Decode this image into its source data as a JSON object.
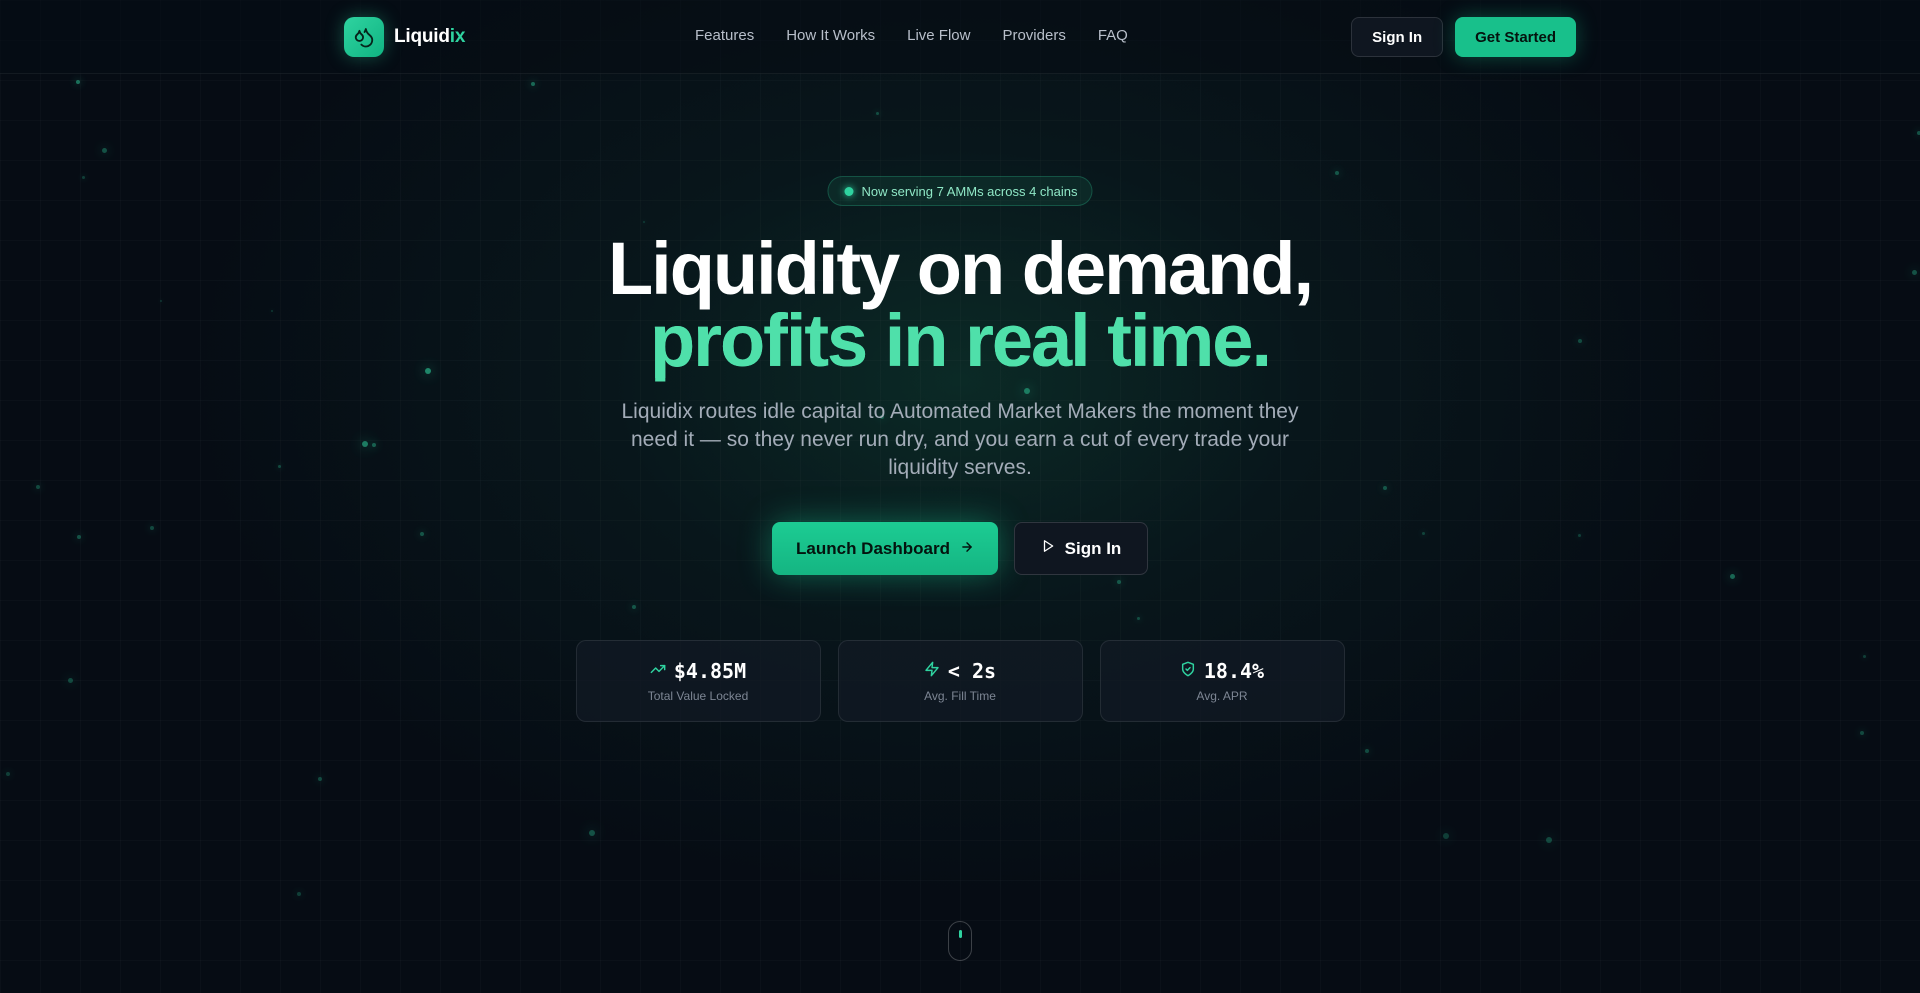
{
  "brand": {
    "name_prefix": "Liquid",
    "name_suffix": "ix",
    "logo_icon": "droplets-icon"
  },
  "nav": {
    "items": [
      {
        "label": "Features"
      },
      {
        "label": "How It Works"
      },
      {
        "label": "Live Flow"
      },
      {
        "label": "Providers"
      },
      {
        "label": "FAQ"
      }
    ]
  },
  "header": {
    "sign_in_label": "Sign In",
    "get_started_label": "Get Started"
  },
  "hero": {
    "badge_text": "Now serving 7 AMMs across 4 chains",
    "headline_line1": "Liquidity on demand,",
    "headline_line2": "profits in real time.",
    "subtitle": "Liquidix routes idle capital to Automated Market Makers the moment they need it — so they never run dry, and you earn a cut of every trade your liquidity serves.",
    "launch_label": "Launch Dashboard",
    "sign_in_label": "Sign In"
  },
  "stats": [
    {
      "icon": "trending-up-icon",
      "value": "$4.85M",
      "label": "Total Value Locked"
    },
    {
      "icon": "zap-icon",
      "value": "< 2s",
      "label": "Avg. Fill Time"
    },
    {
      "icon": "shield-check-icon",
      "value": "18.4%",
      "label": "Avg. APR"
    }
  ],
  "colors": {
    "accent": "#18c08b",
    "accent_light": "#4fe0aa",
    "background": "#060c14"
  }
}
